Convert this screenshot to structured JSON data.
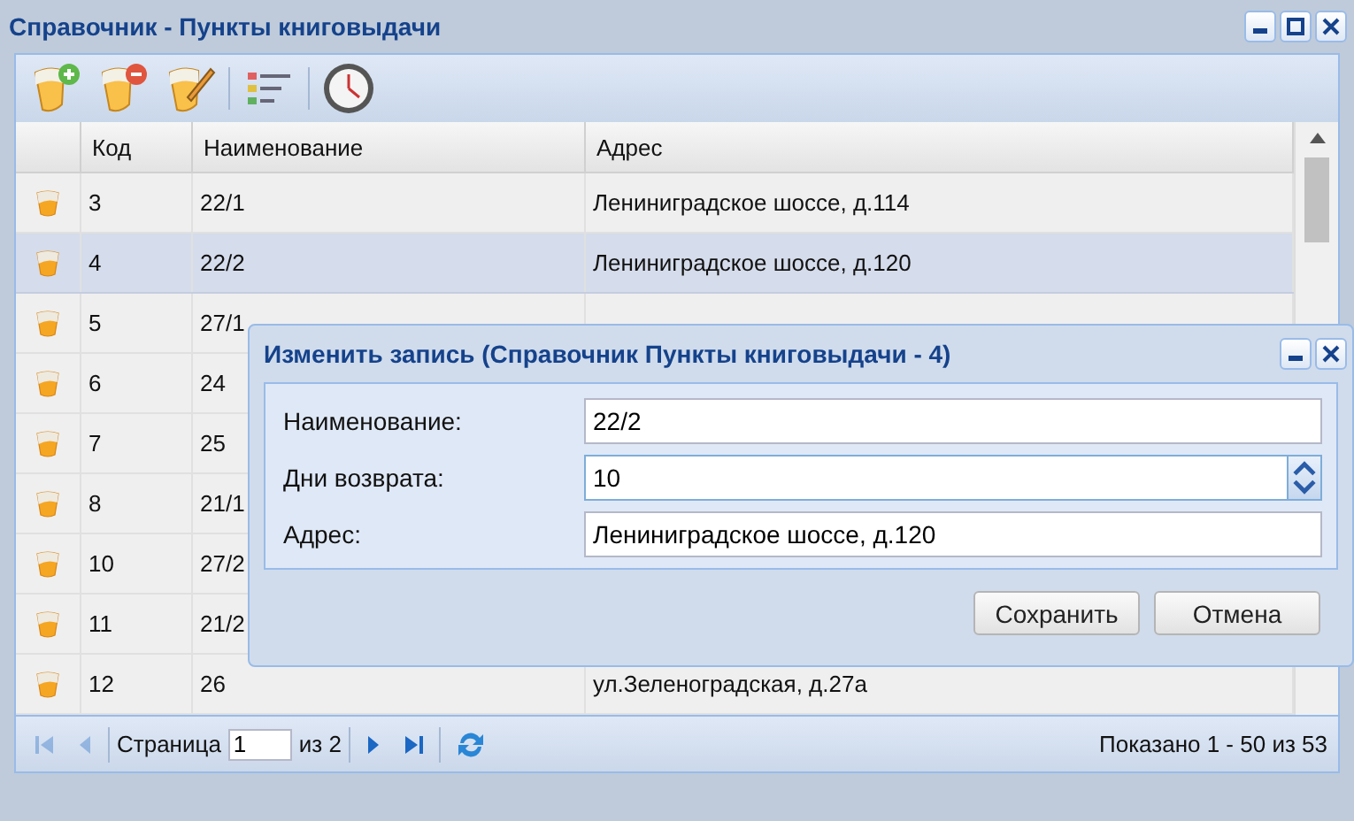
{
  "window": {
    "title": "Справочник - Пункты книговыдачи"
  },
  "toolbar": [
    {
      "kind": "add"
    },
    {
      "kind": "delete"
    },
    {
      "kind": "edit"
    },
    {
      "kind": "list"
    },
    {
      "kind": "clock"
    }
  ],
  "table": {
    "columns": [
      "Код",
      "Наименование",
      "Адрес"
    ],
    "rows": [
      {
        "code": "3",
        "name": "22/1",
        "address": "Лениниградское шоссе, д.114",
        "selected": false
      },
      {
        "code": "4",
        "name": "22/2",
        "address": "Лениниградское шоссе, д.120",
        "selected": true
      },
      {
        "code": "5",
        "name": "27/1",
        "selected": false
      },
      {
        "code": "6",
        "name": "24",
        "selected": false
      },
      {
        "code": "7",
        "name": "25",
        "selected": false
      },
      {
        "code": "8",
        "name": "21/1",
        "selected": false
      },
      {
        "code": "10",
        "name": "27/2",
        "selected": false
      },
      {
        "code": "11",
        "name": "21/2",
        "selected": false
      },
      {
        "code": "12",
        "name": "26",
        "address": "ул.Зеленоградская, д.27а",
        "selected": false
      }
    ]
  },
  "pager": {
    "first_disabled": true,
    "prev_disabled": true,
    "page_label": "Страница",
    "page": "1",
    "of": "из 2",
    "summary": "Показано 1 - 50 из 53"
  },
  "dialog": {
    "title": "Изменить запись (Справочник Пункты книговыдачи - 4)",
    "fields": [
      {
        "label": "Наименование:",
        "value": "22/2",
        "kind": "text"
      },
      {
        "label": "Дни возврата:",
        "value": "10",
        "kind": "spinner"
      },
      {
        "label": "Адрес:",
        "value": "Лениниградское шоссе, д.120",
        "kind": "text"
      }
    ],
    "buttons": [
      "Сохранить",
      "Отмена"
    ]
  }
}
